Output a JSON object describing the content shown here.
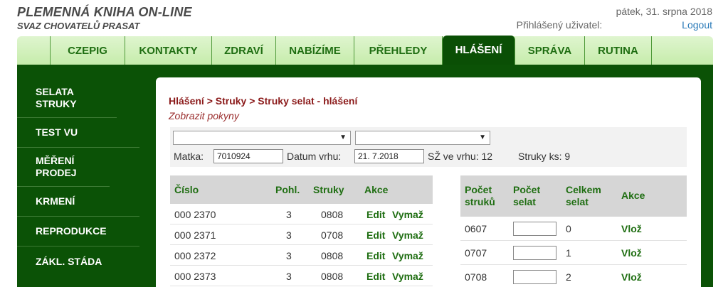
{
  "header": {
    "title": "PLEMENNÁ KNIHA ON-LINE",
    "subtitle": "SVAZ CHOVATELŮ PRASAT",
    "date": "pátek, 31. srpna 2018",
    "user_label": "Přihlášený uživatel:",
    "logout": "Logout"
  },
  "topnav": [
    "CZEPIG",
    "KONTAKTY",
    "ZDRAVÍ",
    "NABÍZÍME",
    "PŘEHLEDY",
    "HLÁŠENÍ",
    "SPRÁVA",
    "RUTINA"
  ],
  "topnav_active": "HLÁŠENÍ",
  "sidebar": [
    "SELATA STRUKY",
    "TEST VU",
    "MĚŘENÍ PRODEJ",
    "KRMENÍ",
    "REPRODUKCE",
    "ZÁKL. STÁDA"
  ],
  "breadcrumb": "Hlášení > Struky > Struky selat - hlášení",
  "hint": "Zobrazit pokyny",
  "filters": {
    "matka_label": "Matka:",
    "matka_value": "7010924",
    "datum_label": "Datum vrhu:",
    "datum_value": "21. 7.2018",
    "sz_text": "SŽ ve vrhu: 12",
    "struky_text": "Struky ks: 9"
  },
  "left_table": {
    "headers": [
      "Číslo",
      "Pohl.",
      "Struky",
      "Akce"
    ],
    "rows": [
      {
        "cislo": "000 2370",
        "pohl": "3",
        "struky": "0808",
        "edit": "Edit",
        "vymaz": "Vymaž"
      },
      {
        "cislo": "000 2371",
        "pohl": "3",
        "struky": "0708",
        "edit": "Edit",
        "vymaz": "Vymaž"
      },
      {
        "cislo": "000 2372",
        "pohl": "3",
        "struky": "0808",
        "edit": "Edit",
        "vymaz": "Vymaž"
      },
      {
        "cislo": "000 2373",
        "pohl": "3",
        "struky": "0808",
        "edit": "Edit",
        "vymaz": "Vymaž"
      }
    ]
  },
  "right_table": {
    "headers": [
      "Počet\nstruků",
      "Počet\nselat",
      "Celkem\nselat",
      "Akce"
    ],
    "rows": [
      {
        "pocet_struku": "0607",
        "celkem": "0",
        "akce": "Vlož"
      },
      {
        "pocet_struku": "0707",
        "celkem": "1",
        "akce": "Vlož"
      },
      {
        "pocet_struku": "0708",
        "celkem": "2",
        "akce": "Vlož"
      }
    ]
  },
  "colors": {
    "dark_green": "#0b5206",
    "tab_text": "#1f6e12",
    "breadcrumb": "#8b1a1a",
    "link_blue": "#2a7ab8"
  }
}
